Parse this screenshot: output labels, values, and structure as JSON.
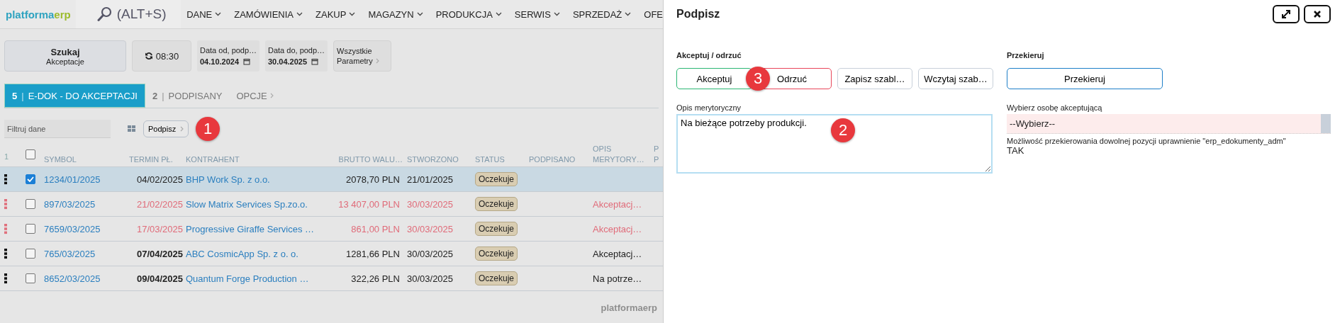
{
  "nav": {
    "logo": {
      "main": "platforma",
      "accent": "erp"
    },
    "search_label": "(ALT+S)",
    "menu": [
      "DANE",
      "ZAMÓWIENIA",
      "ZAKUP",
      "MAGAZYN",
      "PRODUKCJA",
      "SERWIS",
      "SPRZEDAŻ",
      "OFE"
    ]
  },
  "toolbar": {
    "search_button": {
      "title": "Szukaj",
      "subtitle": "Akceptacje"
    },
    "refresh_button": "08:30",
    "date_fields": [
      {
        "label": "Data od, podp…",
        "value": "04.10.2024"
      },
      {
        "label": "Data do, podp…",
        "value": "30.04.2025"
      }
    ],
    "params_button": {
      "lines": [
        "Wszystkie",
        "Parametry"
      ]
    }
  },
  "tabs": [
    {
      "count": "5",
      "separator": "|",
      "label": "E-DOK - DO AKCEPTACJI",
      "selected": true
    },
    {
      "count": "2",
      "separator": "|",
      "label": "PODPISANY",
      "selected": false
    },
    {
      "label": "OPCJE",
      "selected": false
    }
  ],
  "filter": {
    "placeholder": "Filtruj dane",
    "action_button": "Podpisz",
    "marker": "1"
  },
  "table": {
    "row_count_label": "1",
    "header_checked": false,
    "columns": [
      [
        "SYMBOL"
      ],
      [
        "TERMIN PŁ."
      ],
      [
        "KONTRAHENT"
      ],
      [
        "BRUTTO WALU…"
      ],
      [
        "STWORZONO"
      ],
      [
        "STATUS"
      ],
      [
        "PODPISANO"
      ],
      [
        "OPIS",
        "MERYTORY…"
      ],
      [
        "P",
        "P"
      ]
    ],
    "rows": [
      {
        "symbol": "1234/01/2025",
        "term": "04/02/2025",
        "contractor": "BHP Work Sp. z o.o.",
        "gross": "2078,70 PLN",
        "created": "21/01/2025",
        "status": "Oczekuje",
        "selected": true,
        "checked": true,
        "overdue": false,
        "term_bold": false
      },
      {
        "symbol": "897/03/2025",
        "term": "21/02/2025",
        "contractor": "Slow Matrix Services Sp.zo.o.",
        "gross": "13 407,00 PLN",
        "created": "30/03/2025",
        "status": "Oczekuje",
        "description": "Akceptacj…",
        "selected": false,
        "checked": false,
        "overdue": true,
        "term_bold": false
      },
      {
        "symbol": "7659/03/2025",
        "term": "17/03/2025",
        "contractor": "Progressive Giraffe Services …",
        "gross": "861,00 PLN",
        "created": "30/03/2025",
        "status": "Oczekuje",
        "description": "Akceptacj…",
        "selected": false,
        "checked": false,
        "overdue": true,
        "term_bold": false
      },
      {
        "symbol": "765/03/2025",
        "term": "07/04/2025",
        "contractor": "ABC CosmicApp Sp. z o. o.",
        "gross": "1281,66 PLN",
        "created": "30/03/2025",
        "status": "Oczekuje",
        "description": "Akceptacj…",
        "selected": false,
        "checked": false,
        "overdue": false,
        "term_bold": true
      },
      {
        "symbol": "8652/03/2025",
        "term": "09/04/2025",
        "contractor": "Quantum Forge Production …",
        "gross": "322,26 PLN",
        "created": "30/03/2025",
        "status": "Oczekuje",
        "description": "Na potrze…",
        "selected": false,
        "checked": false,
        "overdue": false,
        "term_bold": true
      }
    ]
  },
  "footer_logo": "platformaerp",
  "dialog": {
    "title": "Podpisz",
    "accept_section": {
      "heading": "Akceptuj / odrzuć",
      "marker": "3",
      "buttons": [
        {
          "kind": "accept",
          "label": "Akceptuj"
        },
        {
          "kind": "reject",
          "label": "Odrzuć"
        },
        {
          "kind": "plain",
          "label": "Zapisz szabl…"
        },
        {
          "kind": "plain",
          "label": "Wczytaj szab…"
        }
      ]
    },
    "description": {
      "label": "Opis merytoryczny",
      "value": "Na bieżące potrzeby produkcji.",
      "marker": "2"
    },
    "redirect_section": {
      "heading": "Przekieruj",
      "button": "Przekieruj",
      "select_label": "Wybierz osobę akceptującą",
      "select_value": "--Wybierz--",
      "note": "Możliwość przekierowania dowolnej pozycji uprawnienie \"erp_edokumenty_adm\"",
      "note_value": "TAK"
    }
  }
}
